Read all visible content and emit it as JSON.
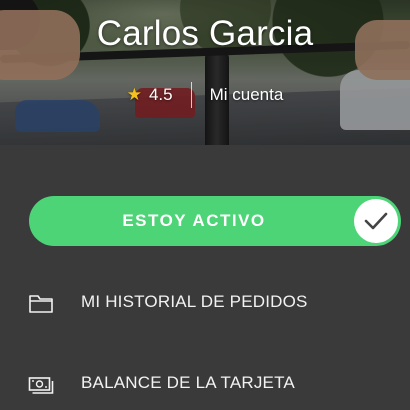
{
  "profile": {
    "name": "Carlos Garcia",
    "rating": "4.5",
    "account_link": "Mi cuenta"
  },
  "status": {
    "label": "ESTOY ACTIVO",
    "active": true,
    "color": "#4dd477"
  },
  "menu": {
    "items": [
      {
        "label": "MI HISTORIAL DE PEDIDOS",
        "icon": "folder-icon"
      },
      {
        "label": "BALANCE DE LA TARJETA",
        "icon": "money-icon"
      }
    ]
  },
  "colors": {
    "background": "#3a3a3a",
    "star": "#f5c21b",
    "text": "#ffffff"
  }
}
